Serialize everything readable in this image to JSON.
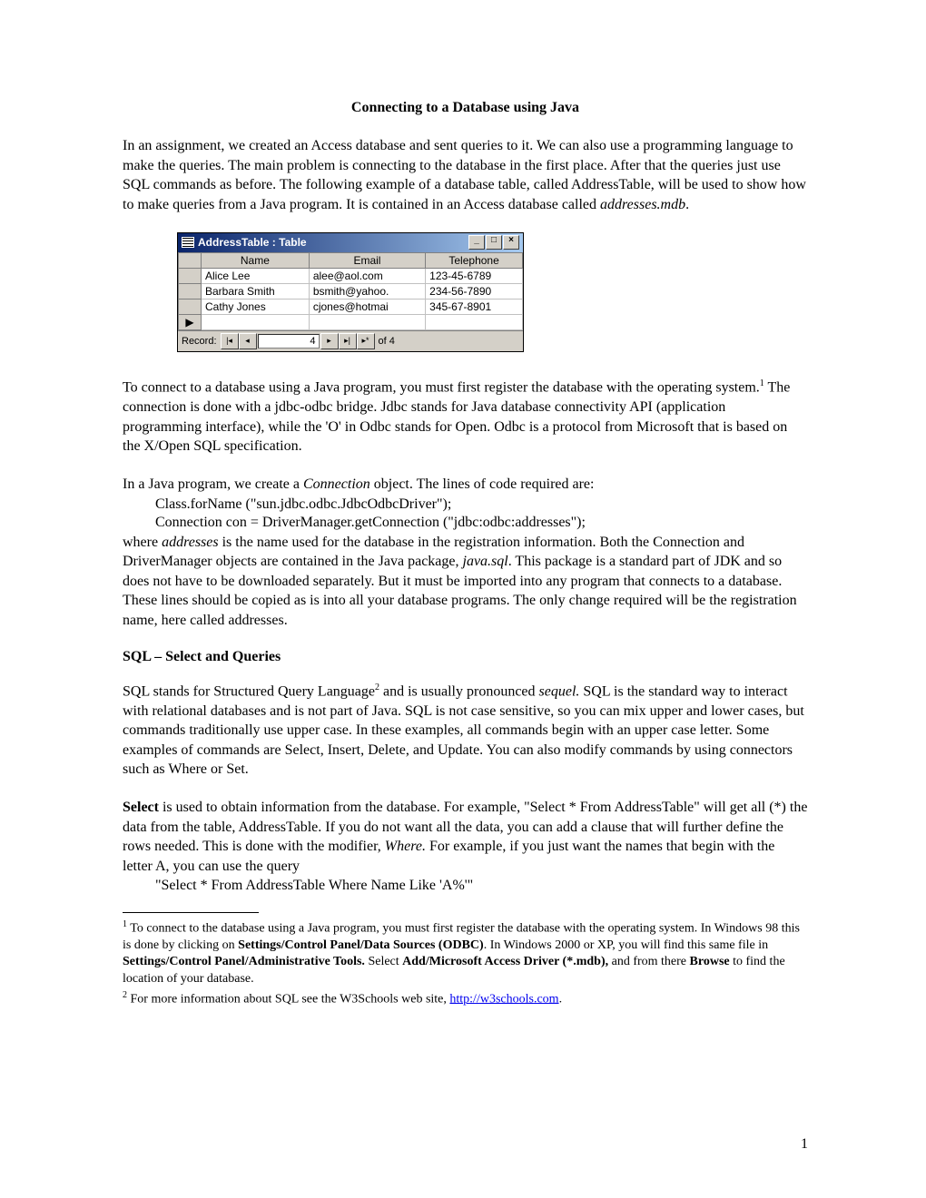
{
  "title": "Connecting to a Database using Java",
  "intro": "In an assignment, we created an Access database and sent queries to it.  We can also use a programming language to make the queries.  The main problem is connecting to the database in the first place.  After that the queries just use SQL commands as before.  The following example of a database table, called AddressTable, will be used to show how to make queries from a Java program.  It is contained in an Access database called ",
  "intro_em": "addresses.mdb",
  "intro_tail": ".",
  "win": {
    "title": "AddressTable : Table",
    "cols": [
      "Name",
      "Email",
      "Telephone"
    ],
    "rows": [
      [
        "Alice Lee",
        "alee@aol.com",
        "123-45-6789"
      ],
      [
        "Barbara Smith",
        "bsmith@yahoo.",
        "234-56-7890"
      ],
      [
        "Cathy Jones",
        "cjones@hotmai",
        "345-67-8901"
      ]
    ],
    "record_label": "Record:",
    "record_value": "4",
    "record_of": "of  4"
  },
  "p2a": "To connect to a database using a Java program, you must first register the database with the operating system.",
  "p2b": "   The connection is done with a jdbc-odbc bridge.  Jdbc stands for Java database connectivity API (application programming interface), while the 'O' in Odbc stands for Open.  Odbc is a protocol from Microsoft that is based on the X/Open SQL specification.",
  "p3a": "In a Java program, we create a ",
  "p3em": "Connection",
  "p3b": " object.  The lines of code required are:",
  "code1": "Class.forName (\"sun.jdbc.odbc.JdbcOdbcDriver\");",
  "code2": "Connection con = DriverManager.getConnection (\"jdbc:odbc:addresses\");",
  "p4a": "where ",
  "p4em": "addresses",
  "p4b": " is the name used for the database in the registration information.  Both the Connection and DriverManager objects are contained in the Java package, ",
  "p4em2": "java.sql",
  "p4c": ".  This package is a standard part of JDK and so does not have to be downloaded separately.  But it must be imported into any program that connects to a database.  These lines should be copied as is into all your database programs.  The only change required will be the registration name, here called addresses.",
  "section": "SQL – Select and Queries",
  "p5a": "SQL stands for Structured Query Language",
  "p5b": " and is usually pronounced ",
  "p5em": "sequel.",
  "p5c": "  SQL is the standard way to interact with relational databases and is not part of Java.   SQL is not case sensitive, so you can mix upper and lower cases, but commands traditionally use upper case.  In these examples, all commands begin with an upper case letter.  Some examples of commands are Select, Insert, Delete, and Update.  You can also modify commands by using connectors such as Where or Set.",
  "p6_bold": "Select",
  "p6a": " is used to obtain information from the database.  For example, \"Select * From AddressTable\" will get all (*) the data from the table, AddressTable.  If you do not want all the data, you can add a clause that will further define the rows needed.  This is done with the modifier, ",
  "p6em": "Where.",
  "p6b": "  For example, if you just want the names that begin with the letter A, you can use the query",
  "code3": "\"Select * From AddressTable Where Name Like 'A%'\"",
  "fn1_mark": "1",
  "fn1a": " To connect to the database using a Java program, you must first register the database with the operating system.  In Windows 98 this is done by clicking on ",
  "fn1b_bold": "Settings/Control Panel/Data Sources (ODBC)",
  "fn1c": ".  In Windows 2000 or XP, you will find this same file in ",
  "fn1d_bold": "Settings/Control Panel/Administrative Tools.",
  "fn1e": "  Select ",
  "fn1f_bold": "Add/Microsoft Access Driver (*.mdb),",
  "fn1g": " and from there ",
  "fn1h_bold": "Browse",
  "fn1i": " to find the location of your database.",
  "fn2_mark": "2",
  "fn2a": " For more information about SQL see the W3Schools web site, ",
  "fn2_link": "http://w3schools.com",
  "fn2b": ".",
  "page_num": "1"
}
